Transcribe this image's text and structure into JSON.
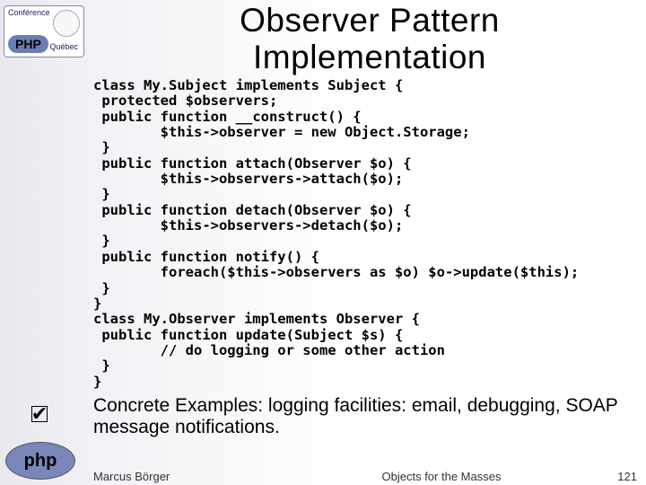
{
  "logo": {
    "top": "Conférence",
    "php": "PHP",
    "qc": "Québec"
  },
  "bubble": "php",
  "checkmark_glyph": "✔",
  "heading_l1": "Observer Pattern",
  "heading_l2": "Implementation",
  "code": "class My.Subject implements Subject {\n protected $observers;\n public function __construct() {\n        $this->observer = new Object.Storage;\n }\n public function attach(Observer $o) {\n        $this->observers->attach($o);\n }\n public function detach(Observer $o) {\n        $this->observers->detach($o);\n }\n public function notify() {\n        foreach($this->observers as $o) $o->update($this);\n }\n}\nclass My.Observer implements Observer {\n public function update(Subject $s) {\n        // do logging or some other action\n }\n}",
  "examples": "Concrete Examples: logging facilities: email, debugging, SOAP message notifications.",
  "footer": {
    "author": "Marcus Börger",
    "title": "Objects for the Masses",
    "page": "121"
  }
}
